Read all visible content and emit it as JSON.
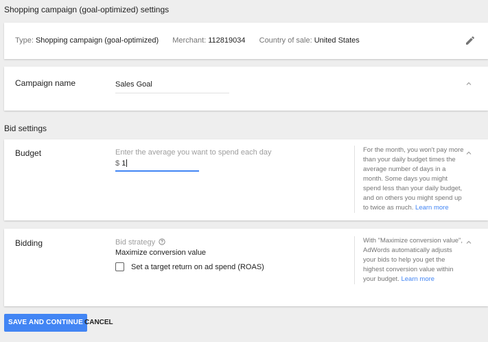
{
  "page": {
    "title": "Shopping campaign (goal-optimized) settings"
  },
  "campaign_info": {
    "type_label": "Type:",
    "type_value": "Shopping campaign (goal-optimized)",
    "merchant_label": "Merchant:",
    "merchant_value": "112819034",
    "country_label": "Country of sale:",
    "country_value": "United States",
    "edit_icon": "pencil-icon"
  },
  "campaign_name": {
    "label": "Campaign name",
    "value": "Sales Goal"
  },
  "bid_settings": {
    "header": "Bid settings"
  },
  "budget": {
    "label": "Budget",
    "hint": "Enter the average you want to spend each day",
    "currency": "$",
    "value": "1",
    "note": "For the month, you won't pay more than your daily budget times the average number of days in a month. Some days you might spend less than your daily budget, and on others you might spend up to twice as much.",
    "note_link": "Learn more"
  },
  "bidding": {
    "label": "Bidding",
    "strategy_label": "Bid strategy",
    "strategy_value": "Maximize conversion value",
    "roas_checkbox_label": "Set a target return on ad spend (ROAS)",
    "roas_checked": false,
    "note": "With \"Maximize conversion value\", AdWords automatically adjusts your bids to help you get the highest conversion value within your budget.",
    "note_link": "Learn more"
  },
  "actions": {
    "save_label": "SAVE AND CONTINUE",
    "cancel_label": "CANCEL"
  },
  "colors": {
    "accent": "#4285f4",
    "background": "#eeeeee",
    "card": "#ffffff"
  }
}
